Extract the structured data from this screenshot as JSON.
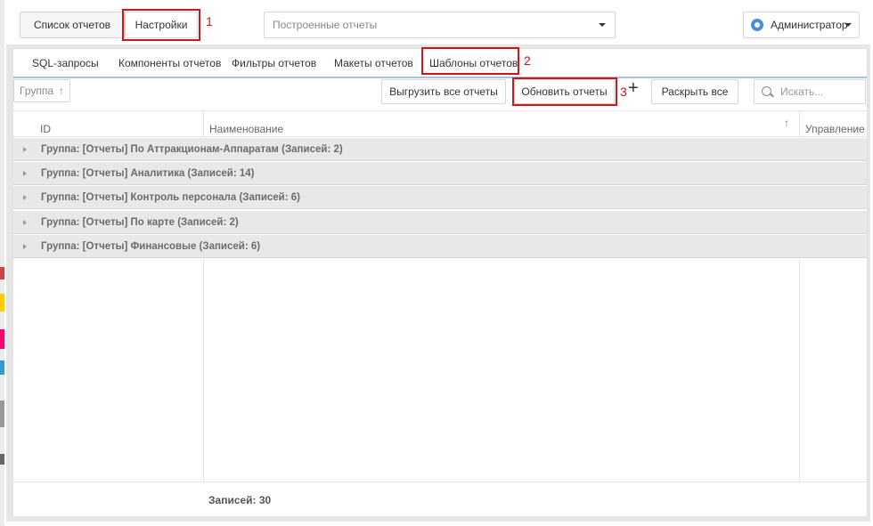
{
  "top": {
    "report_list_button": "Список отчетов",
    "settings_button": "Настройки",
    "built_reports_placeholder": "Построенные отчеты",
    "user_label": "Администратор"
  },
  "tabs": [
    {
      "label": "SQL-запросы"
    },
    {
      "label": "Компоненты отчетов"
    },
    {
      "label": "Фильтры отчетов"
    },
    {
      "label": "Макеты отчетов"
    },
    {
      "label": "Шаблоны отчетов"
    }
  ],
  "toolbar": {
    "group_label": "Группа",
    "export_all_button": "Выгрузить все отчеты",
    "refresh_button": "Обновить отчеты",
    "add_symbol": "+",
    "expand_all_button": "Раскрыть все",
    "search_placeholder": "Искать..."
  },
  "table": {
    "columns": [
      "ID",
      "Наименование",
      "Управление"
    ],
    "groups": [
      "Группа: [Отчеты] По Аттракционам-Аппаратам (Записей: 2)",
      "Группа: [Отчеты] Аналитика (Записей: 14)",
      "Группа: [Отчеты] Контроль персонала (Записей: 6)",
      "Группа: [Отчеты] По карте (Записей: 2)",
      "Группа: [Отчеты] Финансовые (Записей: 6)"
    ],
    "footer_count": "Записей: 30"
  },
  "annotations": [
    "1",
    "2",
    "3"
  ],
  "colors": {
    "highlight": "#d0161b",
    "tab_underline": "#a9c0e0",
    "group_row": "#e8e8e8"
  }
}
